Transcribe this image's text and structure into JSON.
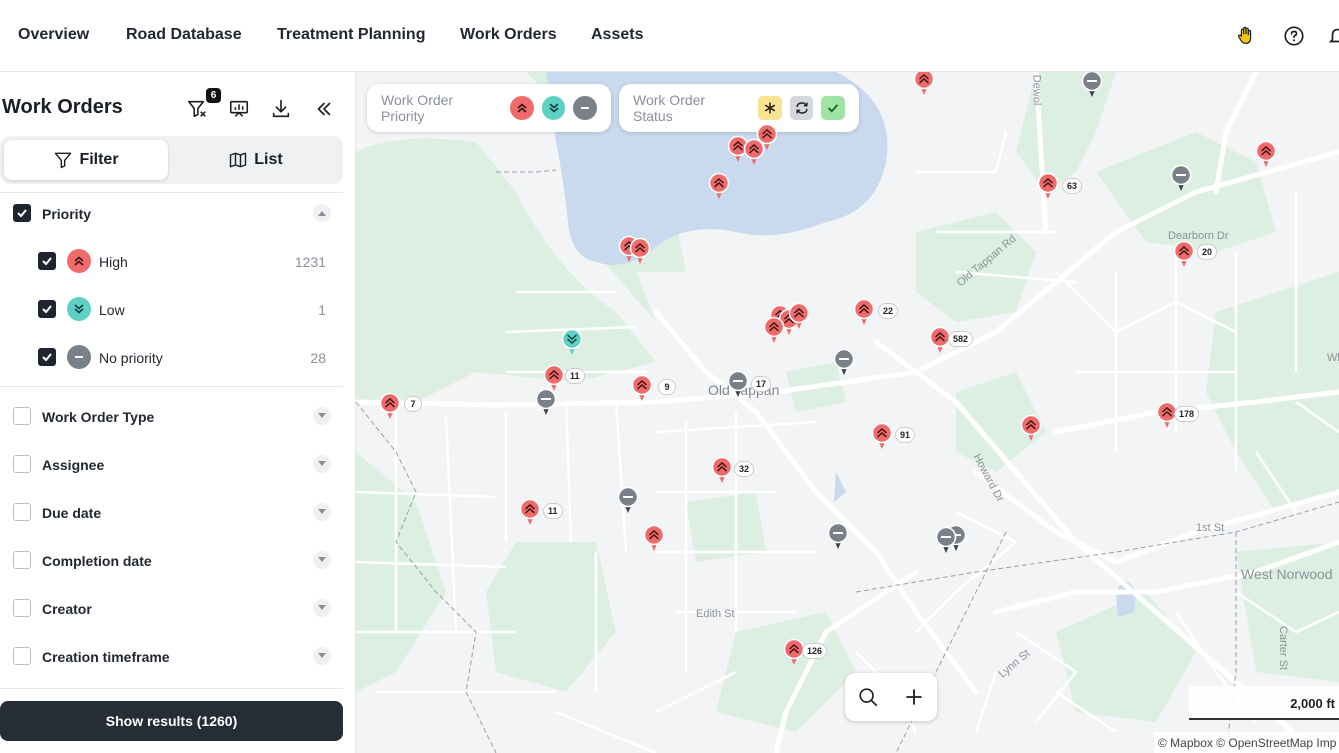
{
  "nav": {
    "items": [
      "Overview",
      "Road Database",
      "Treatment Planning",
      "Work Orders",
      "Assets"
    ]
  },
  "sidebar": {
    "title": "Work Orders",
    "filter_badge": "6",
    "tabs": {
      "filter": "Filter",
      "list": "List"
    },
    "priority": {
      "label": "Priority",
      "options": [
        {
          "label": "High",
          "count": "1231",
          "color": "#ef6b6b"
        },
        {
          "label": "Low",
          "count": "1",
          "color": "#5fd0c6"
        },
        {
          "label": "No priority",
          "count": "28",
          "color": "#7a8089"
        }
      ]
    },
    "sections": [
      "Work Order Type",
      "Assignee",
      "Due date",
      "Completion date",
      "Creator",
      "Creation timeframe"
    ],
    "show_results": "Show results (1260)"
  },
  "map": {
    "legend_priority": "Work Order Priority",
    "legend_status": "Work Order Status",
    "place_labels": {
      "old_tappan": "Old Tappan",
      "west_norwood": "West Norwood",
      "old_tappan_rd": "Old Tappan Rd",
      "dearborn_dr": "Dearborn Dr",
      "howard_dr": "Howard Dr",
      "first_st": "1st St",
      "edith_st": "Edith St",
      "lynn_st": "Lynn St",
      "carter_st": "Carter St",
      "dewolf": "Dewol",
      "wh": "Wh"
    },
    "cluster_counts": [
      "63",
      "20",
      "22",
      "582",
      "11",
      "9",
      "17",
      "7",
      "178",
      "91",
      "32",
      "11",
      "126"
    ],
    "scale": "2,000 ft",
    "attribution": "© Mapbox © OpenStreetMap  Imp"
  },
  "colors": {
    "high": "#ef6b6b",
    "low": "#5fd0c6",
    "none": "#7a8089",
    "dark": "#262d37",
    "water": "#c9d9ee",
    "park": "#dcefe2"
  }
}
